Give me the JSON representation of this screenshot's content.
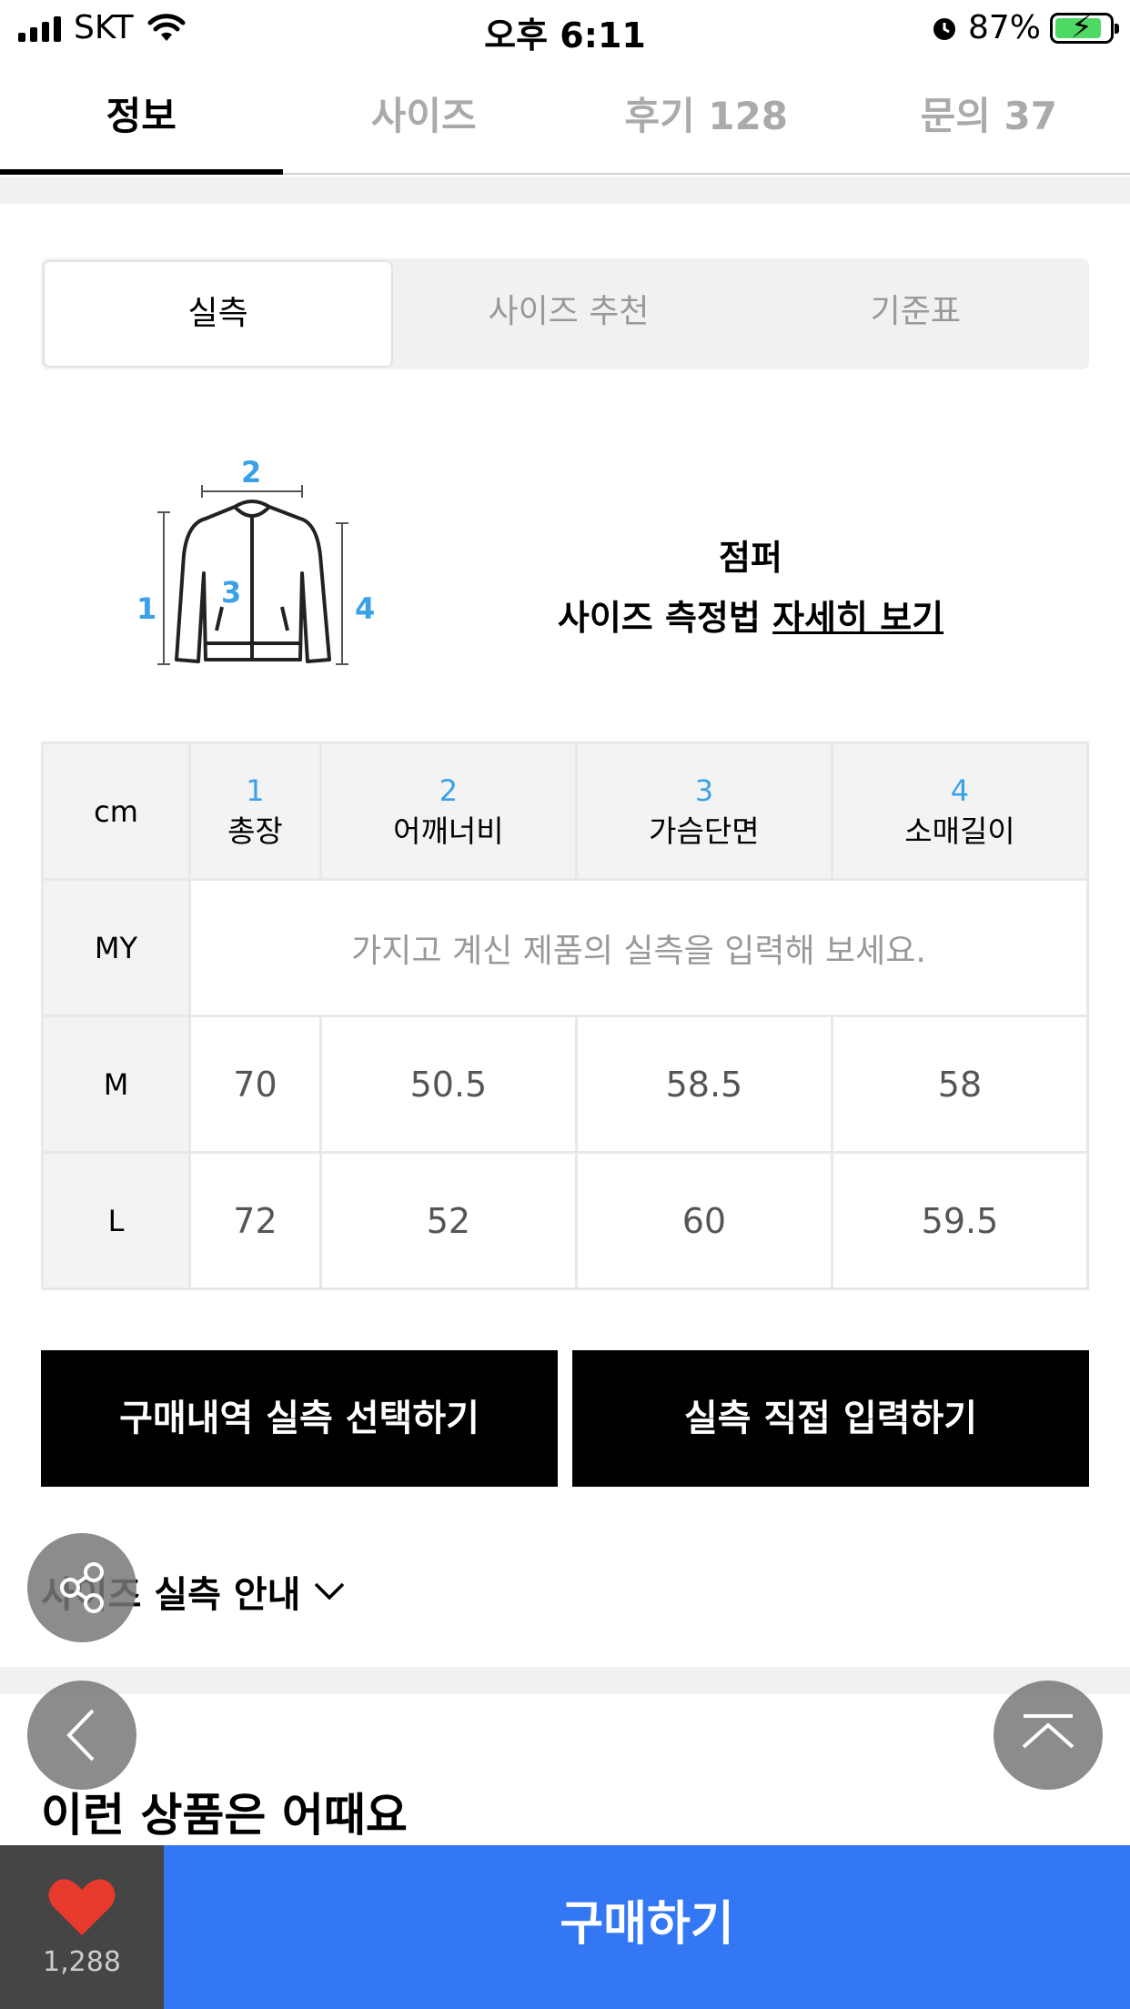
{
  "status_bar": {
    "carrier": "SKT",
    "time": "오후 6:11",
    "battery": "87%"
  },
  "main_tabs": [
    {
      "label": "정보",
      "active": true
    },
    {
      "label": "사이즈",
      "active": false
    },
    {
      "label": "후기 128",
      "active": false
    },
    {
      "label": "문의 37",
      "active": false
    }
  ],
  "sub_tabs": [
    {
      "label": "실측",
      "active": true
    },
    {
      "label": "사이즈 추천",
      "active": false
    },
    {
      "label": "기준표",
      "active": false
    }
  ],
  "figure": {
    "labels": [
      "1",
      "2",
      "3",
      "4"
    ],
    "product_type": "점퍼",
    "method_text": "사이즈 측정법",
    "detail_link": "자세히 보기"
  },
  "size_table": {
    "unit": "cm",
    "columns": [
      {
        "num": "1",
        "name": "총장"
      },
      {
        "num": "2",
        "name": "어깨너비"
      },
      {
        "num": "3",
        "name": "가슴단면"
      },
      {
        "num": "4",
        "name": "소매길이"
      }
    ],
    "my_row": {
      "label": "MY",
      "placeholder": "가지고 계신 제품의 실측을 입력해 보세요."
    },
    "rows": [
      {
        "size": "M",
        "values": [
          "70",
          "50.5",
          "58.5",
          "58"
        ]
      },
      {
        "size": "L",
        "values": [
          "72",
          "52",
          "60",
          "59.5"
        ]
      }
    ]
  },
  "buttons": {
    "select_purchase": "구매내역 실측 선택하기",
    "direct_input": "실측 직접 입력하기"
  },
  "guide": {
    "label": "사이즈 실측 안내"
  },
  "recommend": {
    "title": "이런 상품은 어때요"
  },
  "bottom_bar": {
    "like_count": "1,288",
    "buy_label": "구매하기"
  },
  "colors": {
    "accent_blue": "#3477f5",
    "measure_blue": "#3aa0e8",
    "heart_red": "#e8392d"
  }
}
